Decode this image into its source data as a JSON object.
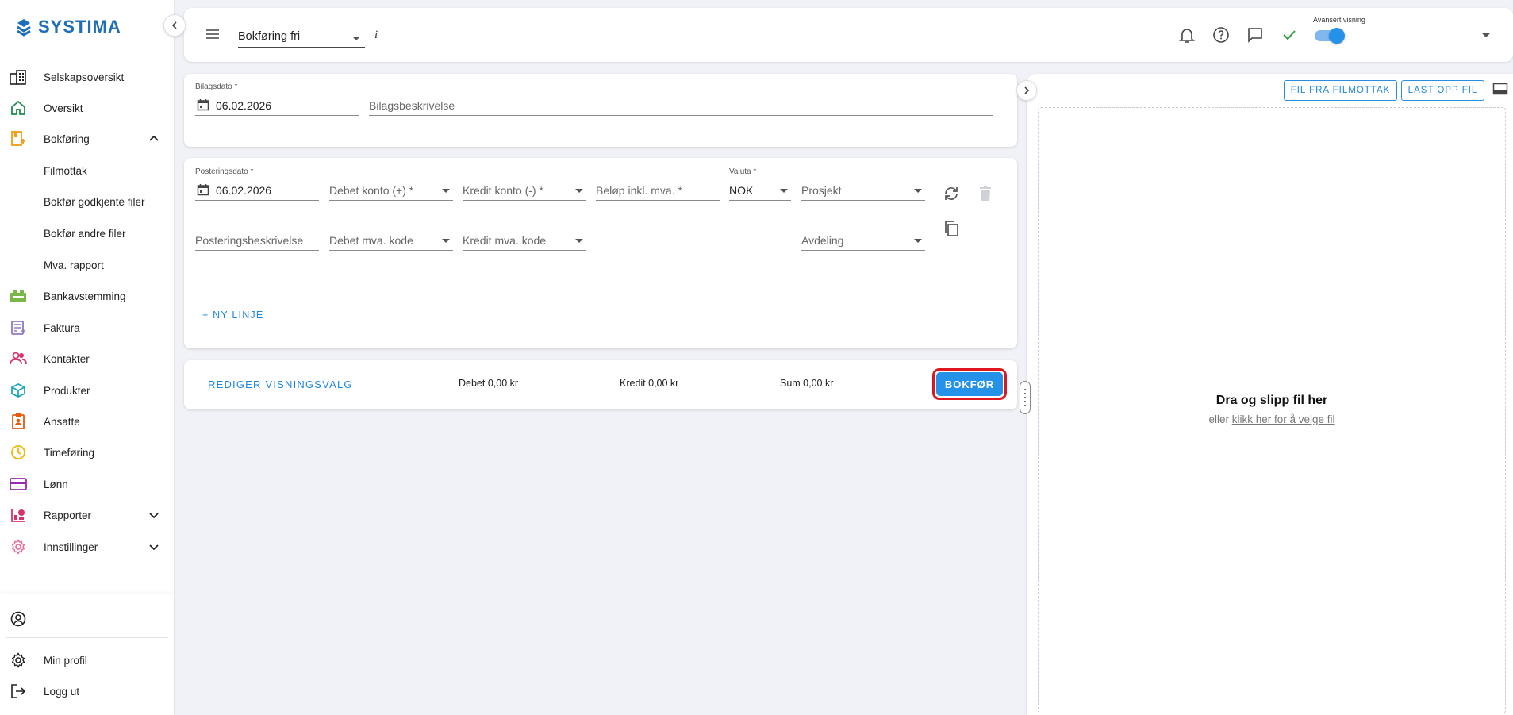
{
  "brand": {
    "name": "SYSTIMA",
    "color": "#1e6fb8"
  },
  "sidebar": {
    "items": [
      {
        "label": "Selskapsoversikt",
        "icon": "building-icon",
        "color": "#222"
      },
      {
        "label": "Oversikt",
        "icon": "home-icon",
        "color": "#1f8a4c"
      },
      {
        "label": "Bokføring",
        "icon": "ledger-icon",
        "color": "#f39c12",
        "expanded": true
      },
      {
        "label": "Filmottak",
        "sub": true
      },
      {
        "label": "Bokfør godkjente filer",
        "sub": true
      },
      {
        "label": "Bokfør andre filer",
        "sub": true
      },
      {
        "label": "Mva. rapport",
        "sub": true
      },
      {
        "label": "Bankavstemming",
        "icon": "bank-icon",
        "color": "#7ab648"
      },
      {
        "label": "Faktura",
        "icon": "invoice-icon",
        "color": "#8e7cc3"
      },
      {
        "label": "Kontakter",
        "icon": "people-icon",
        "color": "#d6336c"
      },
      {
        "label": "Produkter",
        "icon": "cube-icon",
        "color": "#17a2b8"
      },
      {
        "label": "Ansatte",
        "icon": "badge-icon",
        "color": "#e8590c"
      },
      {
        "label": "Timeføring",
        "icon": "clock-icon",
        "color": "#f5b700"
      },
      {
        "label": "Lønn",
        "icon": "card-icon",
        "color": "#9c27b0"
      },
      {
        "label": "Rapporter",
        "icon": "report-icon",
        "color": "#d6336c",
        "collapsed": true
      },
      {
        "label": "Innstillinger",
        "icon": "settings-icon",
        "color": "#f06595",
        "collapsed": true
      }
    ],
    "bottom": {
      "profile": "Min profil",
      "logout": "Logg ut"
    }
  },
  "header": {
    "mode": "Bokføring fri",
    "info": "i",
    "advanced_label": "Avansert visning",
    "advanced_on": true,
    "accent": "#2492e9",
    "check_color": "#2e9e44"
  },
  "voucher": {
    "date_label": "Bilagsdato *",
    "date_value": "06.02.2026",
    "description_placeholder": "Bilagsbeskrivelse"
  },
  "posting": {
    "date_label": "Posteringsdato *",
    "date_value": "06.02.2026",
    "debit_account": "Debet konto (+) *",
    "credit_account": "Kredit konto (-) *",
    "amount": "Beløp inkl. mva. *",
    "currency_label": "Valuta *",
    "currency_value": "NOK",
    "project": "Prosjekt",
    "description": "Posteringsbeskrivelse",
    "debit_vat": "Debet mva. kode",
    "credit_vat": "Kredit mva. kode",
    "department": "Avdeling",
    "new_line": "+ NY LINJE"
  },
  "footer": {
    "edit_view": "REDIGER VISNINGSVALG",
    "debit": "Debet 0,00 kr",
    "credit": "Kredit 0,00 kr",
    "sum": "Sum 0,00 kr",
    "post_button": "BOKFØR",
    "post_color": "#2492e9",
    "highlight_color": "#e0161e"
  },
  "files": {
    "from_inbox": "FIL FRA FILMOTTAK",
    "upload": "LAST OPP FIL",
    "drop_title": "Dra og slipp fil her",
    "drop_or": "eller",
    "drop_link": "klikk her for å velge fil"
  }
}
